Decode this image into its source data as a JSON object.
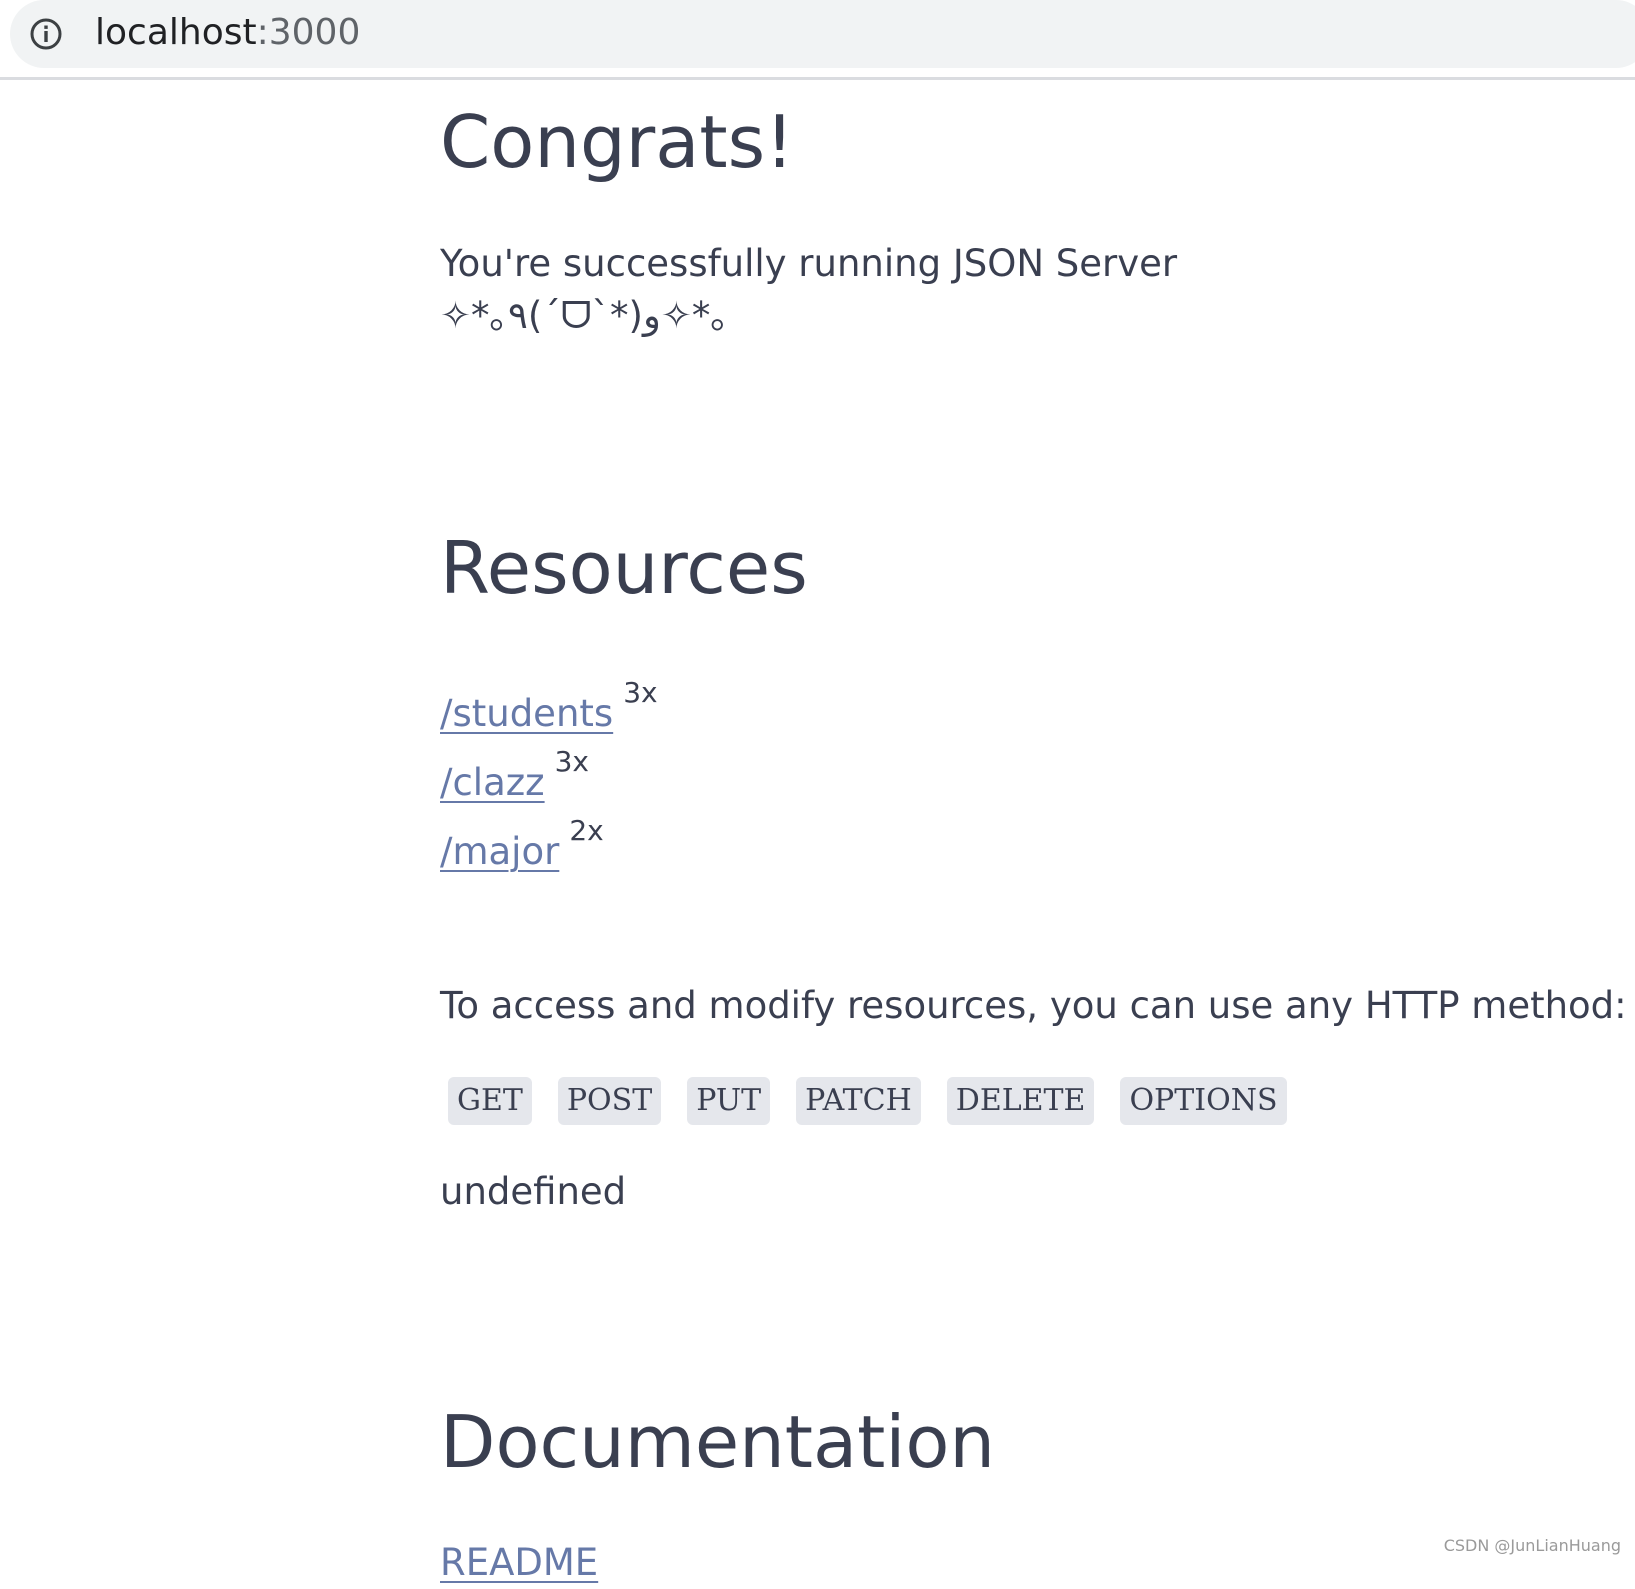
{
  "browser": {
    "url_host": "localhost",
    "url_port": ":3000",
    "info_icon": "info-icon"
  },
  "page": {
    "congrats_title": "Congrats!",
    "running_text": "You're successfully running JSON Server",
    "kaomoji": "✧*｡٩(ˊᗜˋ*)و✧*｡",
    "resources_title": "Resources",
    "resources": [
      {
        "path": "/students",
        "count": "3x"
      },
      {
        "path": "/clazz",
        "count": "3x"
      },
      {
        "path": "/major",
        "count": "2x"
      }
    ],
    "access_text": "To access and modify resources, you can use any HTTP method:",
    "methods": [
      "GET",
      "POST",
      "PUT",
      "PATCH",
      "DELETE",
      "OPTIONS"
    ],
    "undefined_text": "undefined",
    "documentation_title": "Documentation",
    "readme_link": "README"
  },
  "watermark": "CSDN @JunLianHuang",
  "colors": {
    "link": "#6679a8",
    "text": "#3a3f50",
    "method_bg": "#e5e7ec",
    "addressbar_bg": "#f1f3f4"
  }
}
